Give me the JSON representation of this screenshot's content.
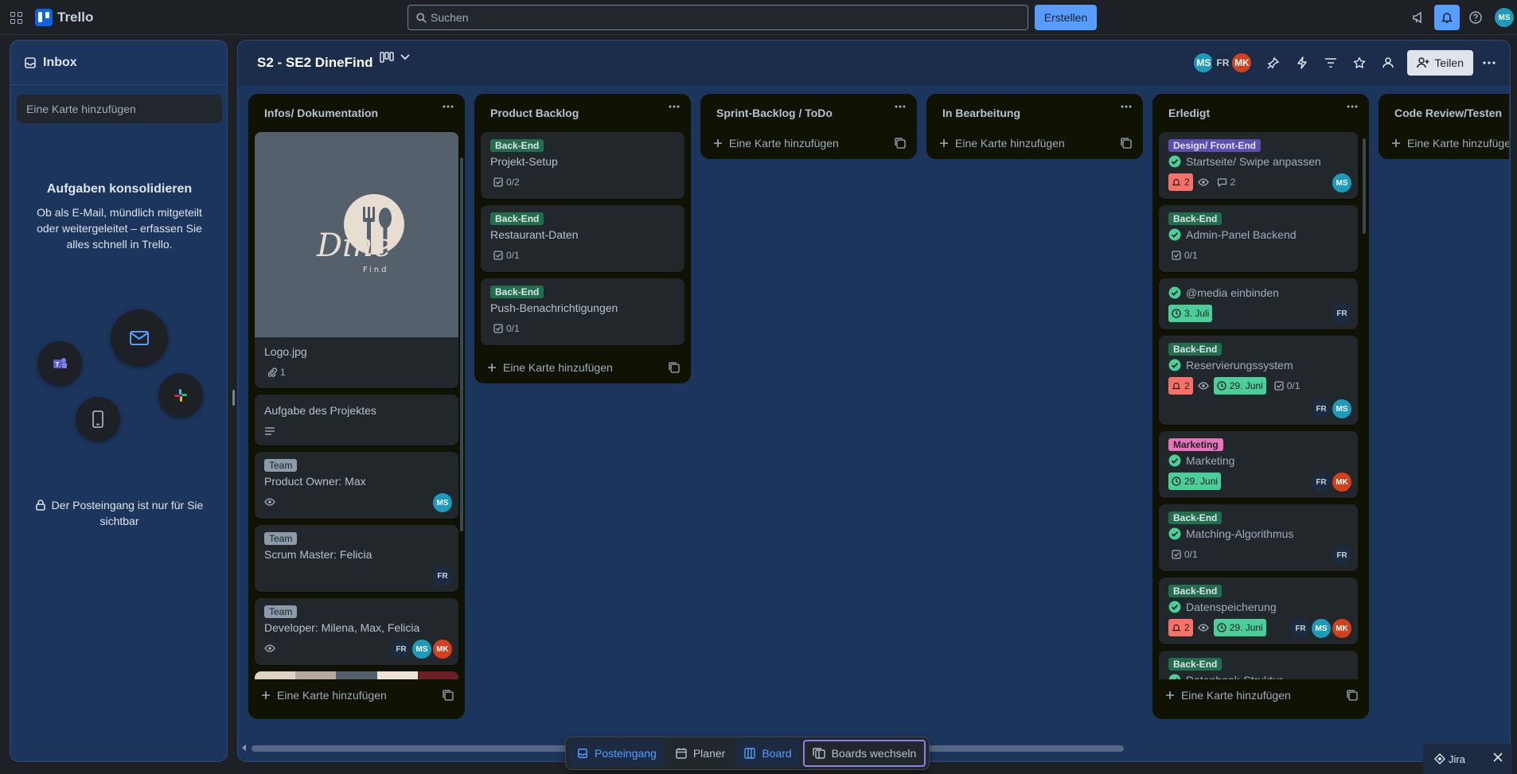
{
  "topbar": {
    "app_name": "Trello",
    "search_placeholder": "Suchen",
    "create_label": "Erstellen",
    "user_initials": "MS"
  },
  "inbox": {
    "title": "Inbox",
    "add_card_placeholder": "Eine Karte hinzufügen",
    "headline": "Aufgaben konsolidieren",
    "description": "Ob als E-Mail, mündlich mitgeteilt oder weitergeleitet – erfassen Sie alles schnell in Trello.",
    "privacy_note": "Der Posteingang ist nur für Sie sichtbar"
  },
  "board": {
    "title": "S2 - SE2 DineFind",
    "members": [
      "MS",
      "FR",
      "MK"
    ],
    "share_label": "Teilen"
  },
  "lists": [
    {
      "title": "Infos/ Dokumentation",
      "add_label": "Eine Karte hinzufügen",
      "cards": [
        {
          "title": "Logo.jpg",
          "attachments": "1",
          "logo_text_1": "Dine",
          "logo_text_2": "Find"
        },
        {
          "title": "Aufgabe des Projektes"
        },
        {
          "label": "Team",
          "title": "Product Owner: Max",
          "members": [
            "MS"
          ]
        },
        {
          "label": "Team",
          "title": "Scrum Master: Felicia",
          "members": [
            "FR"
          ]
        },
        {
          "label": "Team",
          "title": "Developer: Milena, Max, Felicia",
          "members": [
            "FR",
            "MS",
            "MK"
          ]
        }
      ]
    },
    {
      "title": "Product Backlog",
      "add_label": "Eine Karte hinzufügen",
      "cards": [
        {
          "label": "Back-End",
          "title": "Projekt-Setup",
          "checklist": "0/2"
        },
        {
          "label": "Back-End",
          "title": "Restaurant-Daten",
          "checklist": "0/1"
        },
        {
          "label": "Back-End",
          "title": "Push-Benachrichtigungen",
          "checklist": "0/1"
        }
      ]
    },
    {
      "title": "Sprint-Backlog / ToDo",
      "add_label": "Eine Karte hinzufügen"
    },
    {
      "title": "In Bearbeitung",
      "add_label": "Eine Karte hinzufügen"
    },
    {
      "title": "Erledigt",
      "add_label": "Eine Karte hinzufügen",
      "cards": [
        {
          "label": "Design/ Front-End",
          "title": "Startseite/ Swipe anpassen",
          "notifications": "2",
          "comments": "2",
          "members": [
            "MS"
          ]
        },
        {
          "label": "Back-End",
          "title": "Admin-Panel Backend",
          "checklist": "0/1"
        },
        {
          "title": "@media einbinden",
          "due": "3. Juli",
          "members": [
            "FR"
          ]
        },
        {
          "label": "Back-End",
          "title": "Reservierungssystem",
          "notifications": "2",
          "due": "29. Juni",
          "checklist": "0/1",
          "members": [
            "FR",
            "MS"
          ]
        },
        {
          "label": "Marketing",
          "title": "Marketing",
          "due": "29. Juni",
          "members": [
            "FR",
            "MK"
          ]
        },
        {
          "label": "Back-End",
          "title": "Matching-Algorithmus",
          "checklist": "0/1",
          "members": [
            "FR"
          ]
        },
        {
          "label": "Back-End",
          "title": "Datenspeicherung",
          "notifications": "2",
          "due": "29. Juni",
          "members": [
            "FR",
            "MS",
            "MK"
          ]
        },
        {
          "label": "Back-End",
          "title": "Datenbank-Struktur"
        }
      ]
    },
    {
      "title": "Code Review/Testen",
      "add_label": "Eine Karte hinzufügen"
    }
  ],
  "bottom_nav": {
    "inbox": "Posteingang",
    "planner": "Planer",
    "board": "Board",
    "switch": "Boards wechseln"
  },
  "jira": {
    "label": "Jira"
  },
  "colors": {
    "accent": "#579dff",
    "label_green": "#216e4e",
    "label_purple": "#5e4db2",
    "label_pink": "#e774bb",
    "badge_red": "#f87168",
    "badge_green": "#4bce97"
  }
}
